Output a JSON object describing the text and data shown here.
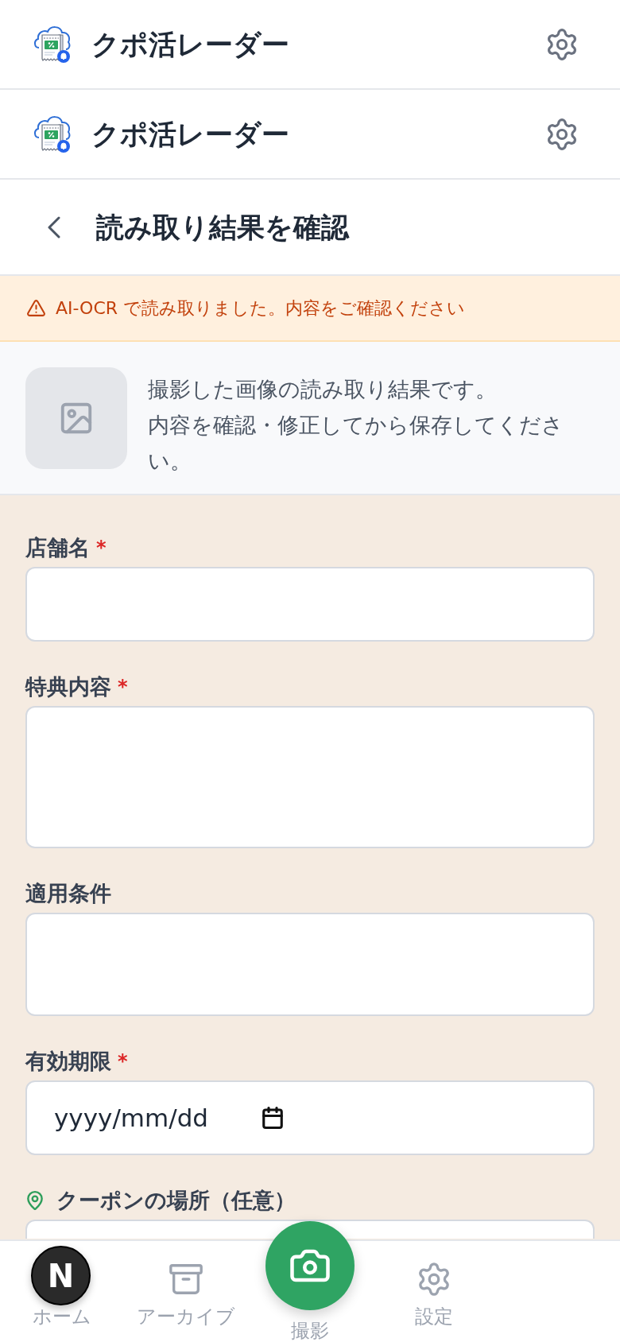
{
  "app_headers": [
    {
      "title": "クポ活レーダー"
    },
    {
      "title": "クポ活レーダー"
    }
  ],
  "page_header": {
    "title": "読み取り結果を確認"
  },
  "notice": {
    "text": "AI-OCR で読み取りました。内容をご確認ください"
  },
  "preview": {
    "lines": [
      "撮影した画像の読み取り結果です。",
      "内容を確認・修正してから保存してください。"
    ]
  },
  "form": {
    "required_mark": "*",
    "fields": [
      {
        "kind": "text",
        "label": "店舗名",
        "required": true
      },
      {
        "kind": "textarea",
        "label": "特典内容",
        "required": true
      },
      {
        "kind": "note",
        "label": "適用条件",
        "required": false
      },
      {
        "kind": "date",
        "label": "有効期限",
        "required": true,
        "placeholder": "yyyy/mm/dd"
      },
      {
        "kind": "location",
        "label": "クーポンの場所（任意）",
        "required": false
      }
    ]
  },
  "bottom_nav": {
    "items": [
      {
        "kind": "home",
        "label": "ホーム",
        "selected": false
      },
      {
        "kind": "archive",
        "label": "アーカイブ",
        "selected": false
      },
      {
        "kind": "camera",
        "label": "撮影",
        "selected": false
      },
      {
        "kind": "settings",
        "label": "設定",
        "selected": false
      }
    ]
  },
  "dev_badge": {
    "label": "N"
  }
}
